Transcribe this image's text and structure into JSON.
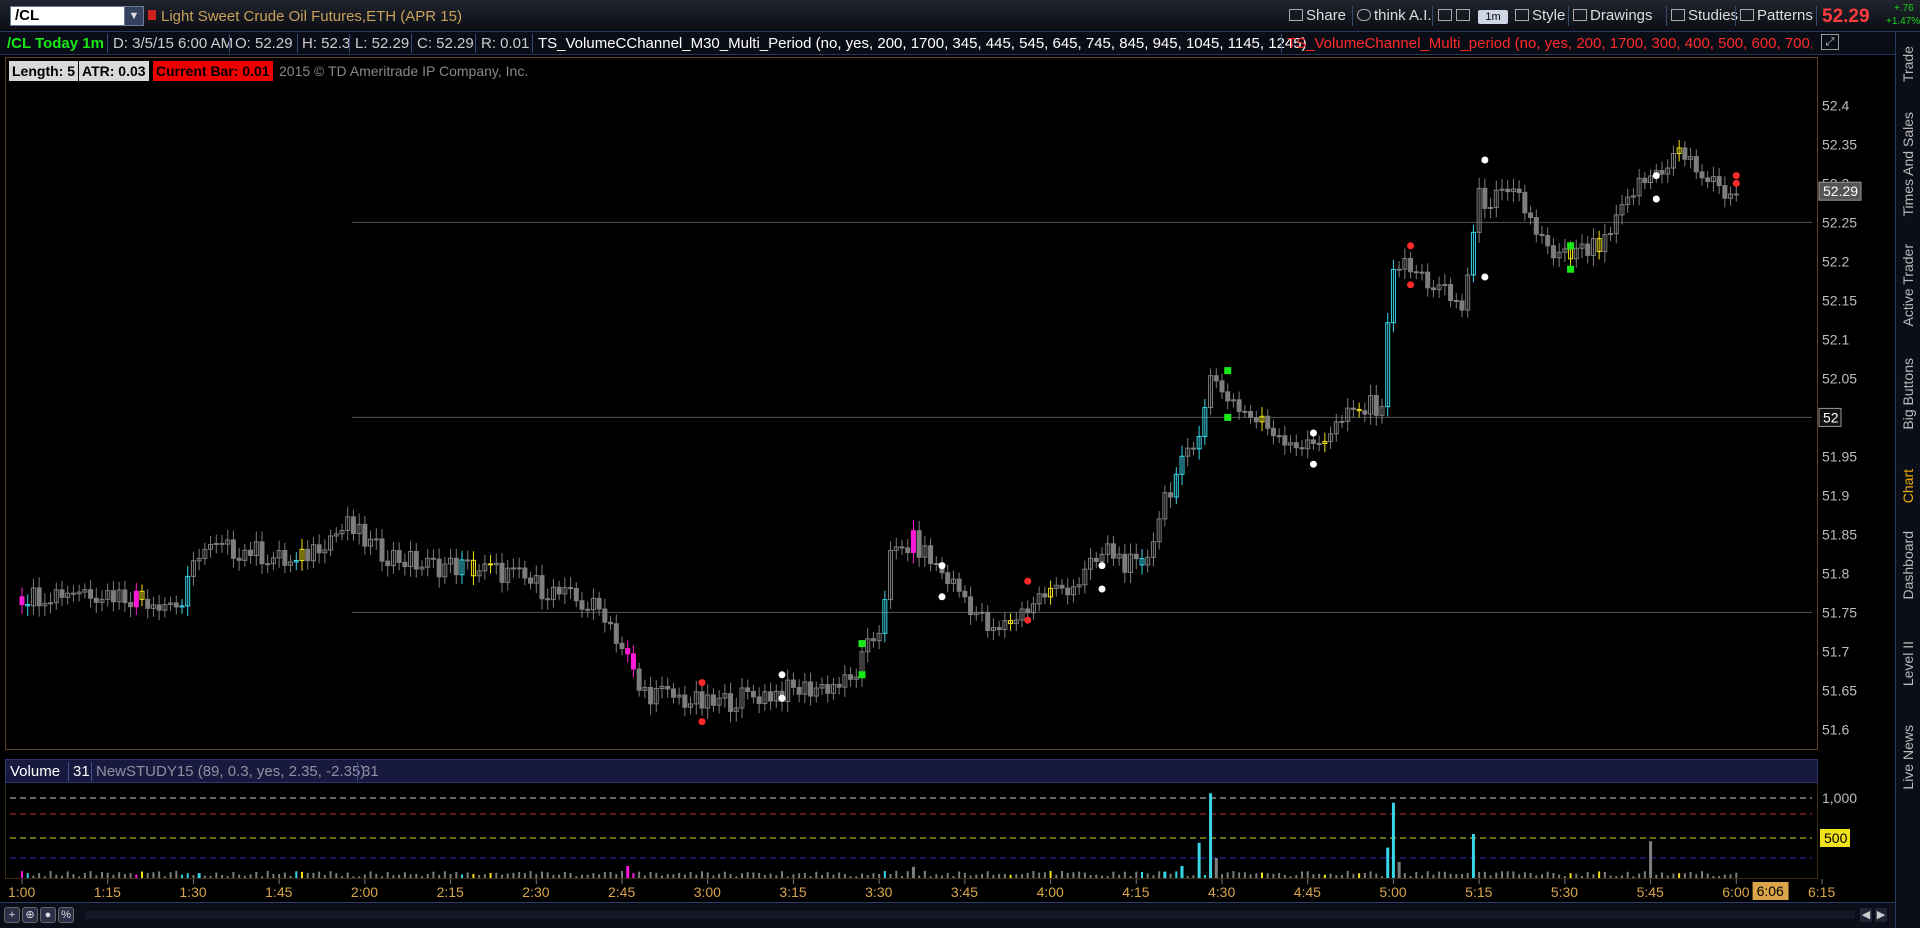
{
  "toolbar": {
    "symbol": "/CL",
    "symbol_description": "Light Sweet Crude Oil Futures,ETH (APR 15)",
    "share_label": "Share",
    "think_ai_label": "think A.I.",
    "timeframe_label": "1m",
    "style_label": "Style",
    "drawings_label": "Drawings",
    "studies_label": "Studies",
    "patterns_label": "Patterns",
    "last_price": "52.29",
    "change_abs": "+.76",
    "change_pct": "+1.47%"
  },
  "infobar": {
    "chart_label": "/CL Today 1m",
    "date": "D: 3/5/15 6:00 AM",
    "open": "O: 52.29",
    "high": "H: 52.3",
    "low": "L: 52.29",
    "close": "C: 52.29",
    "range": "R: 0.01",
    "study1": "TS_VolumeCChannel_M30_Multi_Period (no, yes, 200, 1700, 345, 445, 545, 645, 745, 845, 945, 1045, 1145, 1245)",
    "study2": "TS_VolumeChannel_Multi_period (no, yes, 200, 1700, 300, 400, 500, 600, 700,..."
  },
  "legend": {
    "length": "Length: 5",
    "atr": "ATR: 0.03",
    "current_bar": "Current Bar: 0.01",
    "copyright": "2015 © TD Ameritrade IP Company, Inc."
  },
  "volume_header": {
    "label": "Volume",
    "value": "31",
    "study": "NewSTUDY15 (89, 0.3, yes, 2.35, -2.35)",
    "study_value": "31"
  },
  "right_rail": [
    "Trade",
    "Times And Sales",
    "Active Trader",
    "Big Buttons",
    "Chart",
    "Dashboard",
    "Level II",
    "Live News"
  ],
  "colors": {
    "up": "#39d5e8",
    "down": "#ff1ad9",
    "neutral": "#7d7d7d",
    "signal_yellow": "#f2e21a",
    "dot_red": "#ff2a2a",
    "dot_white": "#ffffff",
    "dot_green": "#18e818",
    "axis_text": "#bdbdbd",
    "time_text": "#d9a44a"
  },
  "chart_data": {
    "type": "candlestick",
    "symbol": "/CL",
    "interval": "1m",
    "price_axis": {
      "min": 51.58,
      "max": 52.43,
      "ticks": [
        "51.6",
        "51.65",
        "51.7",
        "51.75",
        "51.8",
        "51.85",
        "51.9",
        "51.95",
        "52",
        "52.05",
        "52.1",
        "52.15",
        "52.2",
        "52.25",
        "52.3",
        "52.35",
        "52.4"
      ],
      "last_price_label": "52.29",
      "level_label": "52"
    },
    "time_axis": {
      "ticks": [
        "1:00",
        "1:15",
        "1:30",
        "1:45",
        "2:00",
        "2:15",
        "2:30",
        "2:45",
        "3:00",
        "3:15",
        "3:30",
        "3:45",
        "4:00",
        "4:15",
        "4:30",
        "4:45",
        "5:00",
        "5:15",
        "5:30",
        "5:45",
        "6:00",
        "6:15"
      ],
      "current_time_label": "6:06"
    },
    "horizontal_levels": [
      52.25,
      52.0,
      51.75
    ],
    "close_path": [
      {
        "t": "1:00",
        "p": 51.77
      },
      {
        "t": "1:10",
        "p": 51.78
      },
      {
        "t": "1:20",
        "p": 51.77
      },
      {
        "t": "1:28",
        "p": 51.76
      },
      {
        "t": "1:31",
        "p": 51.83
      },
      {
        "t": "1:40",
        "p": 51.83
      },
      {
        "t": "1:48",
        "p": 51.81
      },
      {
        "t": "1:52",
        "p": 51.84
      },
      {
        "t": "1:57",
        "p": 51.86
      },
      {
        "t": "2:02",
        "p": 51.83
      },
      {
        "t": "2:10",
        "p": 51.81
      },
      {
        "t": "2:15",
        "p": 51.81
      },
      {
        "t": "2:25",
        "p": 51.8
      },
      {
        "t": "2:35",
        "p": 51.77
      },
      {
        "t": "2:42",
        "p": 51.75
      },
      {
        "t": "2:46",
        "p": 51.69
      },
      {
        "t": "2:48",
        "p": 51.65
      },
      {
        "t": "2:55",
        "p": 51.64
      },
      {
        "t": "3:00",
        "p": 51.63
      },
      {
        "t": "3:05",
        "p": 51.64
      },
      {
        "t": "3:15",
        "p": 51.65
      },
      {
        "t": "3:25",
        "p": 51.66
      },
      {
        "t": "3:30",
        "p": 51.73
      },
      {
        "t": "3:32",
        "p": 51.82
      },
      {
        "t": "3:36",
        "p": 51.84
      },
      {
        "t": "3:45",
        "p": 51.77
      },
      {
        "t": "3:50",
        "p": 51.72
      },
      {
        "t": "3:58",
        "p": 51.77
      },
      {
        "t": "4:05",
        "p": 51.79
      },
      {
        "t": "4:10",
        "p": 51.83
      },
      {
        "t": "4:16",
        "p": 51.8
      },
      {
        "t": "4:20",
        "p": 51.9
      },
      {
        "t": "4:25",
        "p": 51.96
      },
      {
        "t": "4:28",
        "p": 52.05
      },
      {
        "t": "4:35",
        "p": 52.0
      },
      {
        "t": "4:45",
        "p": 51.96
      },
      {
        "t": "4:52",
        "p": 52.0
      },
      {
        "t": "4:58",
        "p": 52.02
      },
      {
        "t": "5:00",
        "p": 52.2
      },
      {
        "t": "5:05",
        "p": 52.18
      },
      {
        "t": "5:12",
        "p": 52.14
      },
      {
        "t": "5:15",
        "p": 52.28
      },
      {
        "t": "5:22",
        "p": 52.28
      },
      {
        "t": "5:28",
        "p": 52.2
      },
      {
        "t": "5:37",
        "p": 52.22
      },
      {
        "t": "5:42",
        "p": 52.29
      },
      {
        "t": "5:50",
        "p": 52.34
      },
      {
        "t": "5:57",
        "p": 52.29
      },
      {
        "t": "6:00",
        "p": 52.29
      }
    ],
    "colored_bars": [
      {
        "t": "1:00",
        "color": "down"
      },
      {
        "t": "1:01",
        "color": "up"
      },
      {
        "t": "1:20",
        "color": "down"
      },
      {
        "t": "1:21",
        "color": "signal_yellow"
      },
      {
        "t": "1:28",
        "color": "up"
      },
      {
        "t": "1:29",
        "color": "up"
      },
      {
        "t": "1:48",
        "color": "up"
      },
      {
        "t": "1:49",
        "color": "signal_yellow"
      },
      {
        "t": "2:17",
        "color": "up"
      },
      {
        "t": "2:19",
        "color": "signal_yellow"
      },
      {
        "t": "2:22",
        "color": "signal_yellow"
      },
      {
        "t": "2:46",
        "color": "down"
      },
      {
        "t": "2:47",
        "color": "down"
      },
      {
        "t": "2:48",
        "color": "neutral"
      },
      {
        "t": "3:31",
        "color": "up"
      },
      {
        "t": "3:36",
        "color": "down"
      },
      {
        "t": "3:53",
        "color": "signal_yellow"
      },
      {
        "t": "4:00",
        "color": "signal_yellow"
      },
      {
        "t": "4:16",
        "color": "up"
      },
      {
        "t": "4:22",
        "color": "up"
      },
      {
        "t": "4:23",
        "color": "up"
      },
      {
        "t": "4:26",
        "color": "up"
      },
      {
        "t": "4:27",
        "color": "up"
      },
      {
        "t": "4:37",
        "color": "signal_yellow"
      },
      {
        "t": "4:48",
        "color": "signal_yellow"
      },
      {
        "t": "4:54",
        "color": "signal_yellow"
      },
      {
        "t": "4:59",
        "color": "up"
      },
      {
        "t": "5:00",
        "color": "up"
      },
      {
        "t": "5:14",
        "color": "up"
      },
      {
        "t": "5:31",
        "color": "signal_yellow"
      },
      {
        "t": "5:36",
        "color": "signal_yellow"
      },
      {
        "t": "5:50",
        "color": "signal_yellow"
      }
    ],
    "signal_dots": [
      {
        "t": "2:59",
        "p": 51.66,
        "color": "dot_red"
      },
      {
        "t": "2:59",
        "p": 51.61,
        "color": "dot_red"
      },
      {
        "t": "3:13",
        "p": 51.67,
        "color": "dot_white"
      },
      {
        "t": "3:13",
        "p": 51.64,
        "color": "dot_white"
      },
      {
        "t": "3:27",
        "p": 51.71,
        "color": "dot_green"
      },
      {
        "t": "3:27",
        "p": 51.67,
        "color": "dot_green"
      },
      {
        "t": "3:41",
        "p": 51.81,
        "color": "dot_white"
      },
      {
        "t": "3:41",
        "p": 51.77,
        "color": "dot_white"
      },
      {
        "t": "3:56",
        "p": 51.79,
        "color": "dot_red"
      },
      {
        "t": "3:56",
        "p": 51.74,
        "color": "dot_red"
      },
      {
        "t": "4:09",
        "p": 51.81,
        "color": "dot_white"
      },
      {
        "t": "4:09",
        "p": 51.78,
        "color": "dot_white"
      },
      {
        "t": "4:31",
        "p": 52.06,
        "color": "dot_green"
      },
      {
        "t": "4:31",
        "p": 52.0,
        "color": "dot_green"
      },
      {
        "t": "4:46",
        "p": 51.98,
        "color": "dot_white"
      },
      {
        "t": "4:46",
        "p": 51.94,
        "color": "dot_white"
      },
      {
        "t": "5:03",
        "p": 52.22,
        "color": "dot_red"
      },
      {
        "t": "5:03",
        "p": 52.17,
        "color": "dot_red"
      },
      {
        "t": "5:16",
        "p": 52.33,
        "color": "dot_white"
      },
      {
        "t": "5:16",
        "p": 52.18,
        "color": "dot_white"
      },
      {
        "t": "5:31",
        "p": 52.22,
        "color": "dot_green"
      },
      {
        "t": "5:31",
        "p": 52.19,
        "color": "dot_green"
      },
      {
        "t": "5:46",
        "p": 52.31,
        "color": "dot_white"
      },
      {
        "t": "5:46",
        "p": 52.28,
        "color": "dot_white"
      },
      {
        "t": "6:00",
        "p": 52.31,
        "color": "dot_red"
      },
      {
        "t": "6:00",
        "p": 52.3,
        "color": "dot_red"
      }
    ],
    "volume": {
      "axis_ticks": [
        "1,000",
        "500"
      ],
      "guide_levels": [
        1000,
        800,
        500,
        250
      ],
      "spikes": [
        {
          "t": "1:31",
          "v": 60,
          "color": "up"
        },
        {
          "t": "2:46",
          "v": 150,
          "color": "down"
        },
        {
          "t": "3:36",
          "v": 140,
          "color": "neutral"
        },
        {
          "t": "4:20",
          "v": 80,
          "color": "up"
        },
        {
          "t": "4:23",
          "v": 150,
          "color": "up"
        },
        {
          "t": "4:26",
          "v": 440,
          "color": "up"
        },
        {
          "t": "4:28",
          "v": 1060,
          "color": "up"
        },
        {
          "t": "4:29",
          "v": 250,
          "color": "neutral"
        },
        {
          "t": "4:59",
          "v": 380,
          "color": "up"
        },
        {
          "t": "5:00",
          "v": 940,
          "color": "up"
        },
        {
          "t": "5:01",
          "v": 200,
          "color": "neutral"
        },
        {
          "t": "5:14",
          "v": 550,
          "color": "up"
        },
        {
          "t": "5:45",
          "v": 460,
          "color": "neutral"
        }
      ]
    }
  }
}
